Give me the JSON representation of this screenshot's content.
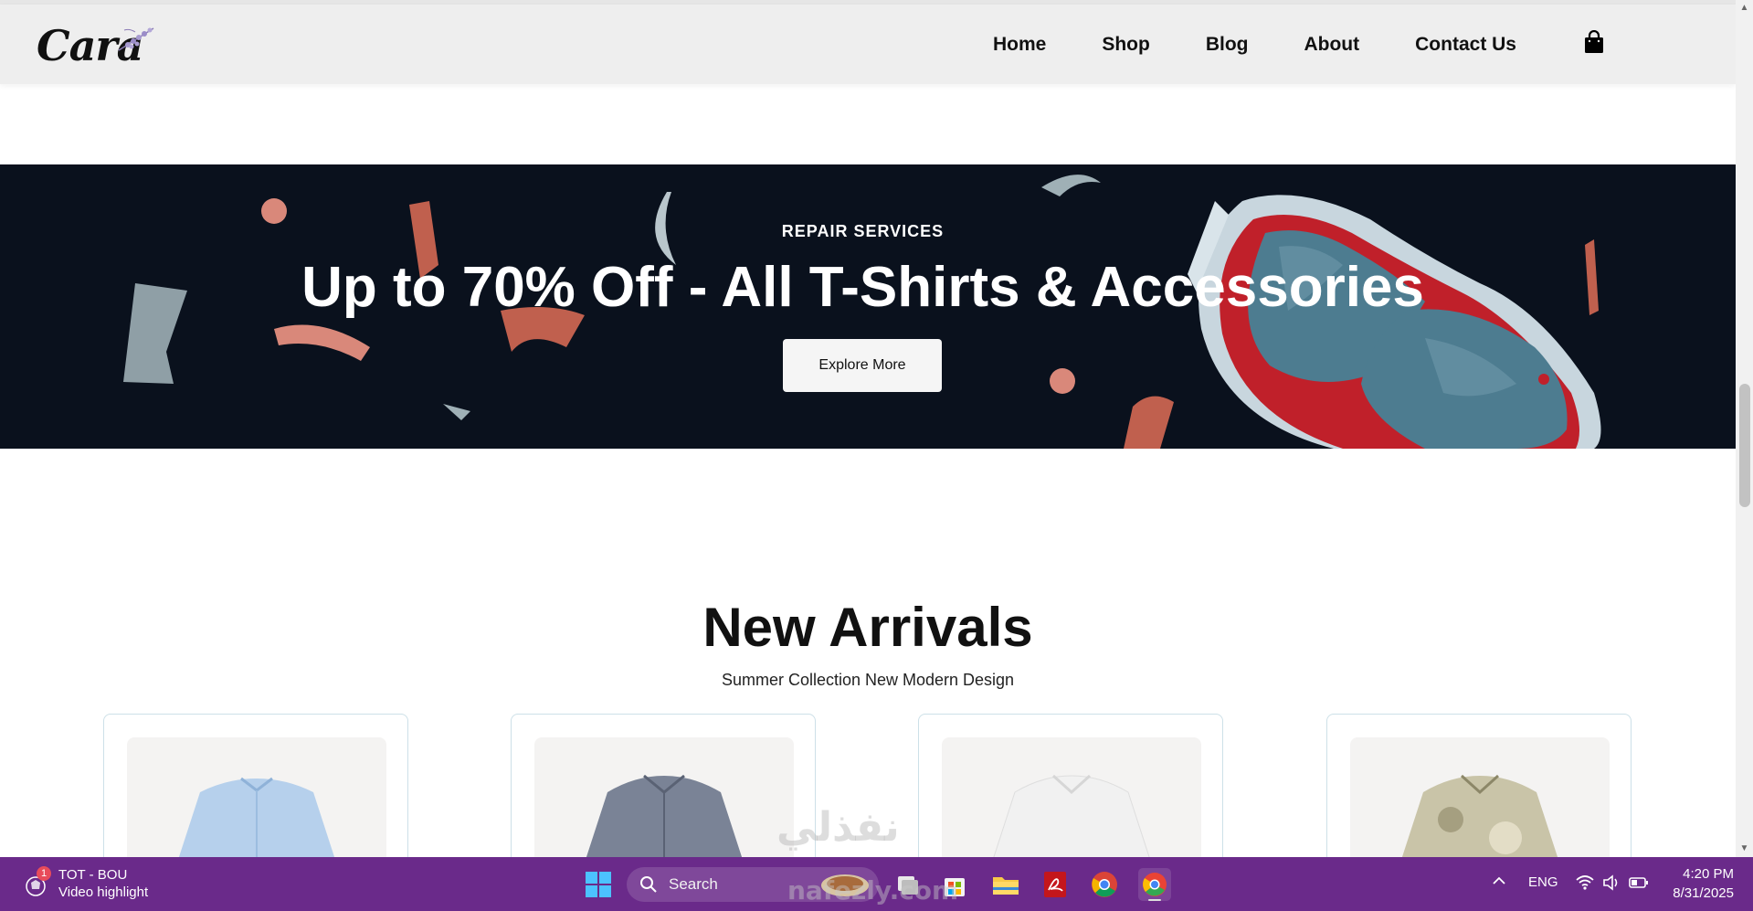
{
  "header": {
    "logo_text": "Cara",
    "nav": [
      "Home",
      "Shop",
      "Blog",
      "About",
      "Contact Us"
    ],
    "cart_icon": "shopping-bag-icon"
  },
  "banner": {
    "subtitle": "REPAIR SERVICES",
    "title": "Up to 70% Off - All T-Shirts & Accessories",
    "button_label": "Explore More",
    "background_color": "#0a111d"
  },
  "arrivals": {
    "title": "New Arrivals",
    "subtitle": "Summer Collection New Modern Design",
    "products": [
      {
        "image": "light-blue-shirt"
      },
      {
        "image": "grey-check-shirt"
      },
      {
        "image": "white-shirt"
      },
      {
        "image": "floral-shirt"
      }
    ]
  },
  "taskbar": {
    "widget_title": "TOT - BOU",
    "widget_subtitle": "Video highlight",
    "widget_badge": "1",
    "search_label": "Search",
    "language": "ENG",
    "time": "4:20 PM",
    "date": "8/31/2025",
    "color": "#6a2a8a"
  },
  "watermark": {
    "text_arabic": "نفذلي",
    "text_latin": "nafezly.com"
  }
}
